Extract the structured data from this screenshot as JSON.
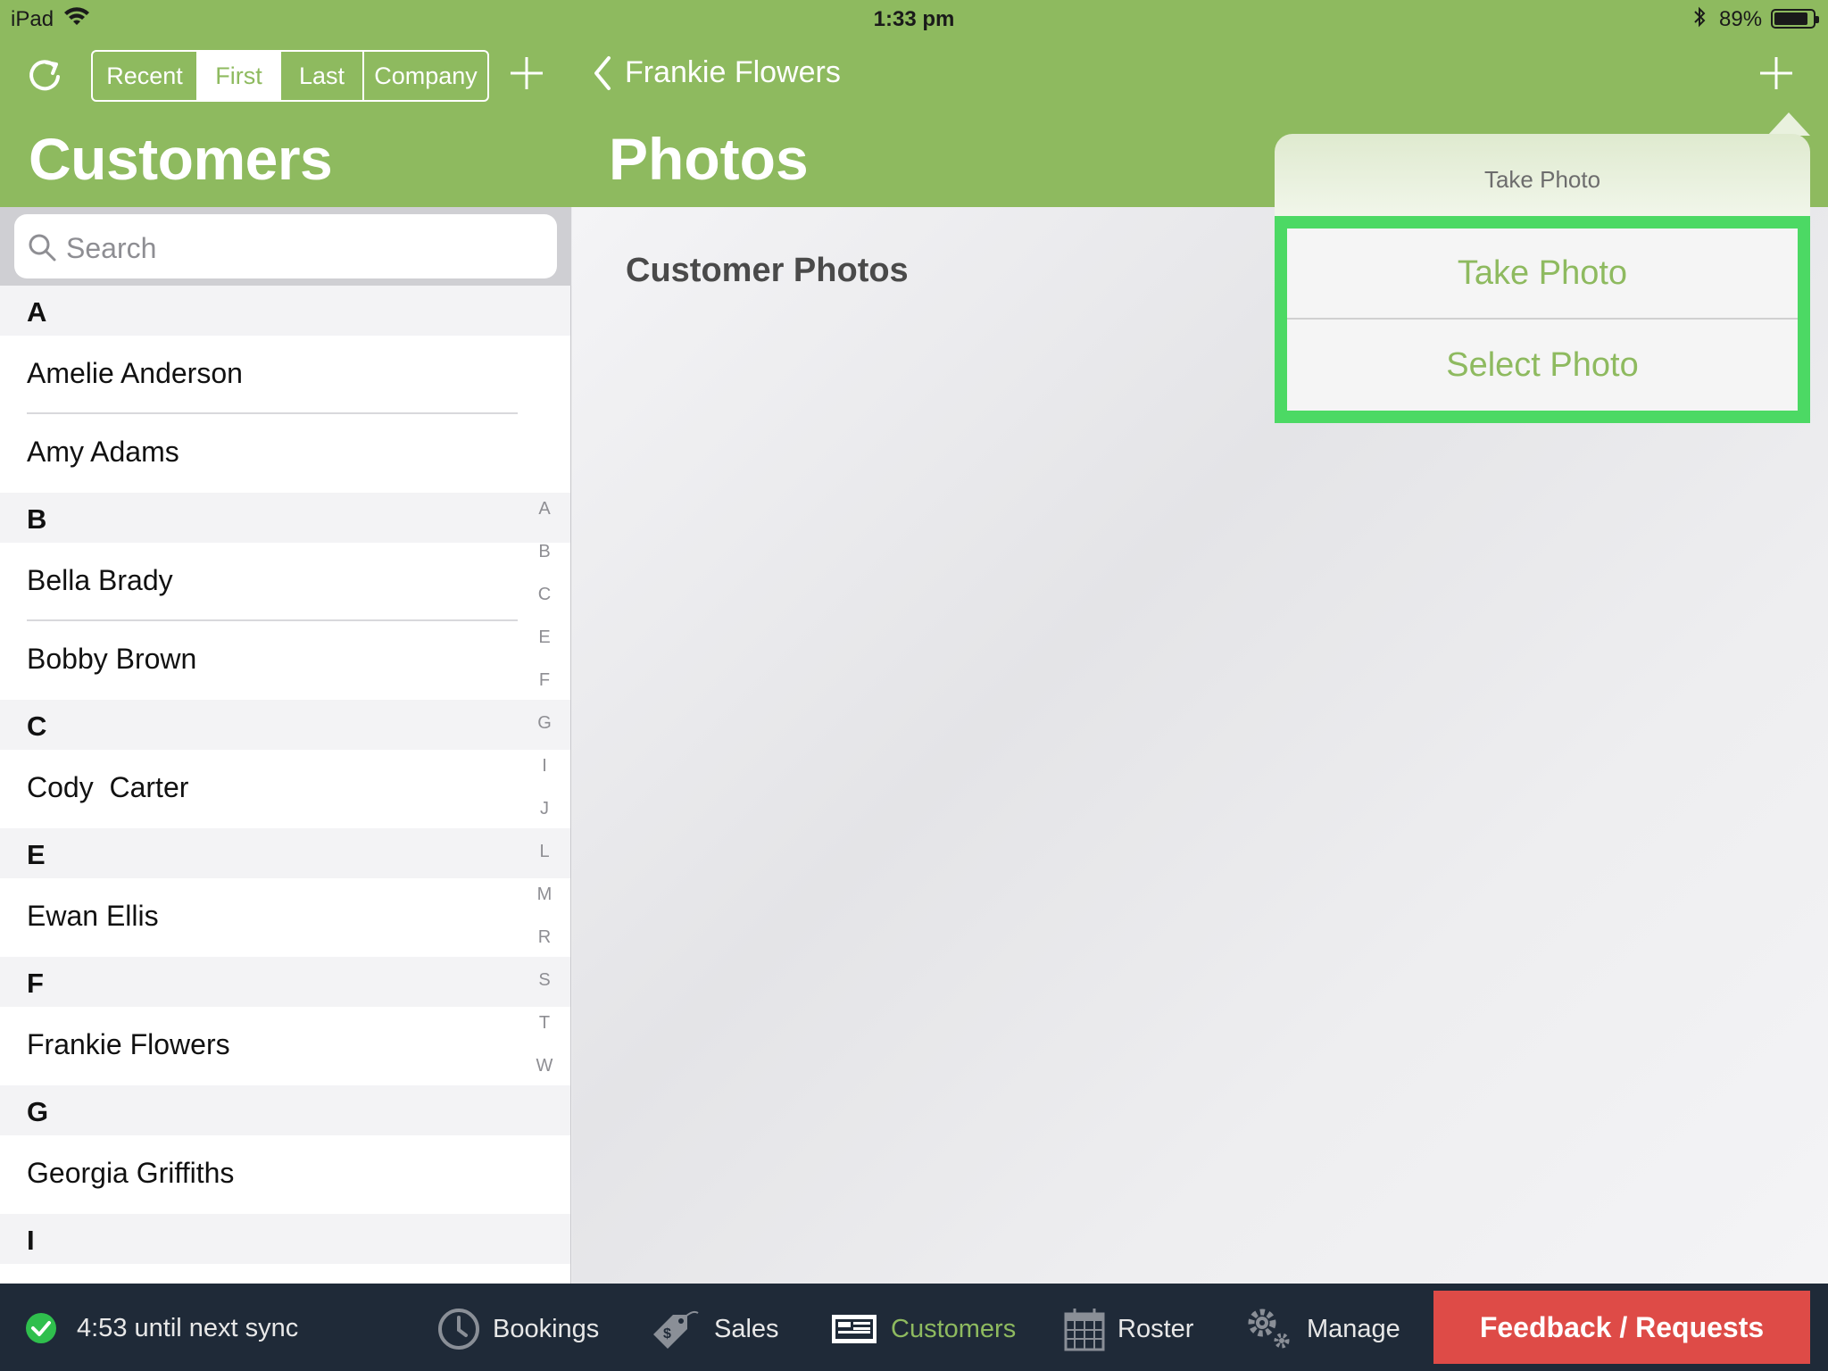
{
  "status_bar": {
    "device": "iPad",
    "time": "1:33 pm",
    "battery_pct": "89%",
    "battery_level": 0.89
  },
  "left_panel": {
    "segments": [
      {
        "label": "Recent",
        "active": false
      },
      {
        "label": "First",
        "active": true
      },
      {
        "label": "Last",
        "active": false
      },
      {
        "label": "Company",
        "active": false
      }
    ],
    "title": "Customers",
    "search_placeholder": "Search",
    "sections": [
      {
        "letter": "A",
        "rows": [
          "Amelie Anderson",
          "Amy Adams"
        ]
      },
      {
        "letter": "B",
        "rows": [
          "Bella Brady",
          "Bobby Brown"
        ]
      },
      {
        "letter": "C",
        "rows": [
          "Cody  Carter"
        ]
      },
      {
        "letter": "E",
        "rows": [
          "Ewan Ellis"
        ]
      },
      {
        "letter": "F",
        "rows": [
          "Frankie Flowers"
        ]
      },
      {
        "letter": "G",
        "rows": [
          "Georgia Griffiths"
        ]
      },
      {
        "letter": "I",
        "rows": []
      }
    ],
    "index_letters": [
      "A",
      "B",
      "C",
      "E",
      "F",
      "G",
      "I",
      "J",
      "L",
      "M",
      "R",
      "S",
      "T",
      "W"
    ]
  },
  "right_panel": {
    "back_label": "Frankie Flowers",
    "title": "Photos",
    "section_title": "Customer Photos"
  },
  "popover": {
    "title": "Take Photo",
    "options": [
      "Take Photo",
      "Select Photo"
    ]
  },
  "bottom_bar": {
    "sync_text": "4:53 until next sync",
    "tabs": [
      {
        "label": "Bookings",
        "icon": "clock-icon",
        "active": false
      },
      {
        "label": "Sales",
        "icon": "price-tag-icon",
        "active": false
      },
      {
        "label": "Customers",
        "icon": "customers-icon",
        "active": true
      },
      {
        "label": "Roster",
        "icon": "calendar-icon",
        "active": false
      },
      {
        "label": "Manage",
        "icon": "gears-icon",
        "active": false
      }
    ],
    "feedback_label": "Feedback / Requests"
  },
  "colors": {
    "brand_green": "#8eba5f",
    "highlight_green": "#4cd964",
    "bottom_bar": "#1f2a38",
    "feedback_red": "#de4b47"
  }
}
